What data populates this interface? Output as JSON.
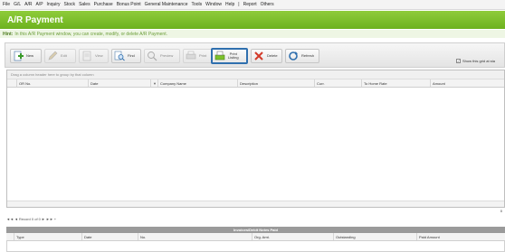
{
  "menu": [
    "File",
    "G/L",
    "A/R",
    "A/P",
    "Inquiry",
    "Stock",
    "Sales",
    "Purchase",
    "Bonus Point",
    "General Maintenance",
    "Tools",
    "Window",
    "Help",
    "|",
    "Report",
    "Others"
  ],
  "title": "A/R Payment",
  "hint": {
    "prefix": "Hint:",
    "text": "In this A/R Payment window, you can create, modify, or delete A/R Payment."
  },
  "toolbar": {
    "new": "New",
    "edit": "Edit",
    "view": "View",
    "find": "Find",
    "preview": "Preview",
    "print": "Print",
    "print_listing_1": "Print",
    "print_listing_2": "Listing",
    "delete": "Delete",
    "refresh": "Refresh"
  },
  "show_grid_label": "Show this grid at sta",
  "show_grid_checked": "✓",
  "grid": {
    "group_hint": "Drag a column header here to group by that column",
    "columns": [
      "OR No.",
      "Date",
      "Company Name",
      "Description",
      "Curr.",
      "To Home Rate",
      "Amount"
    ],
    "sort_indicator": "▼",
    "total": "0"
  },
  "navigator": {
    "first": "◄◄",
    "prev": "◄",
    "record": "Record 0 of 0",
    "next": "►",
    "last": "►►",
    "add": "+"
  },
  "knockoff": {
    "header": "Invoices/Debit Notes Paid",
    "columns": [
      "Type",
      "Date",
      "No.",
      "Org. Amt.",
      "Outstanding",
      "Paid Amount"
    ]
  },
  "colors": {
    "title_green": "#7cc22a",
    "highlight_border": "#2f6fae"
  }
}
